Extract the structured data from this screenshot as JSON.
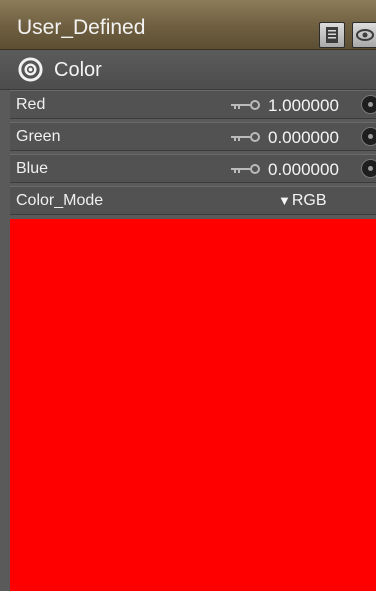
{
  "window": {
    "title": "User_Defined",
    "menu_icon": "list-menu-icon",
    "view_icon": "eye-icon"
  },
  "section": {
    "label": "Color",
    "icon": "eye-toggle-icon"
  },
  "properties": [
    {
      "label": "Red",
      "value": "1.000000",
      "key_icon": "keyframe-key-icon",
      "dial_icon": "dial-knob-icon"
    },
    {
      "label": "Green",
      "value": "0.000000",
      "key_icon": "keyframe-key-icon",
      "dial_icon": "dial-knob-icon"
    },
    {
      "label": "Blue",
      "value": "0.000000",
      "key_icon": "keyframe-key-icon",
      "dial_icon": "dial-knob-icon"
    }
  ],
  "color_mode": {
    "label": "Color_Mode",
    "value": "RGB",
    "arrow": "▼",
    "arrow_icon": "triangle-down-icon"
  },
  "swatch": {
    "color": "#ff0000"
  },
  "colors": {
    "title_bar": "#7a6a4a",
    "panel": "#525252",
    "text": "#f0f0f0"
  }
}
